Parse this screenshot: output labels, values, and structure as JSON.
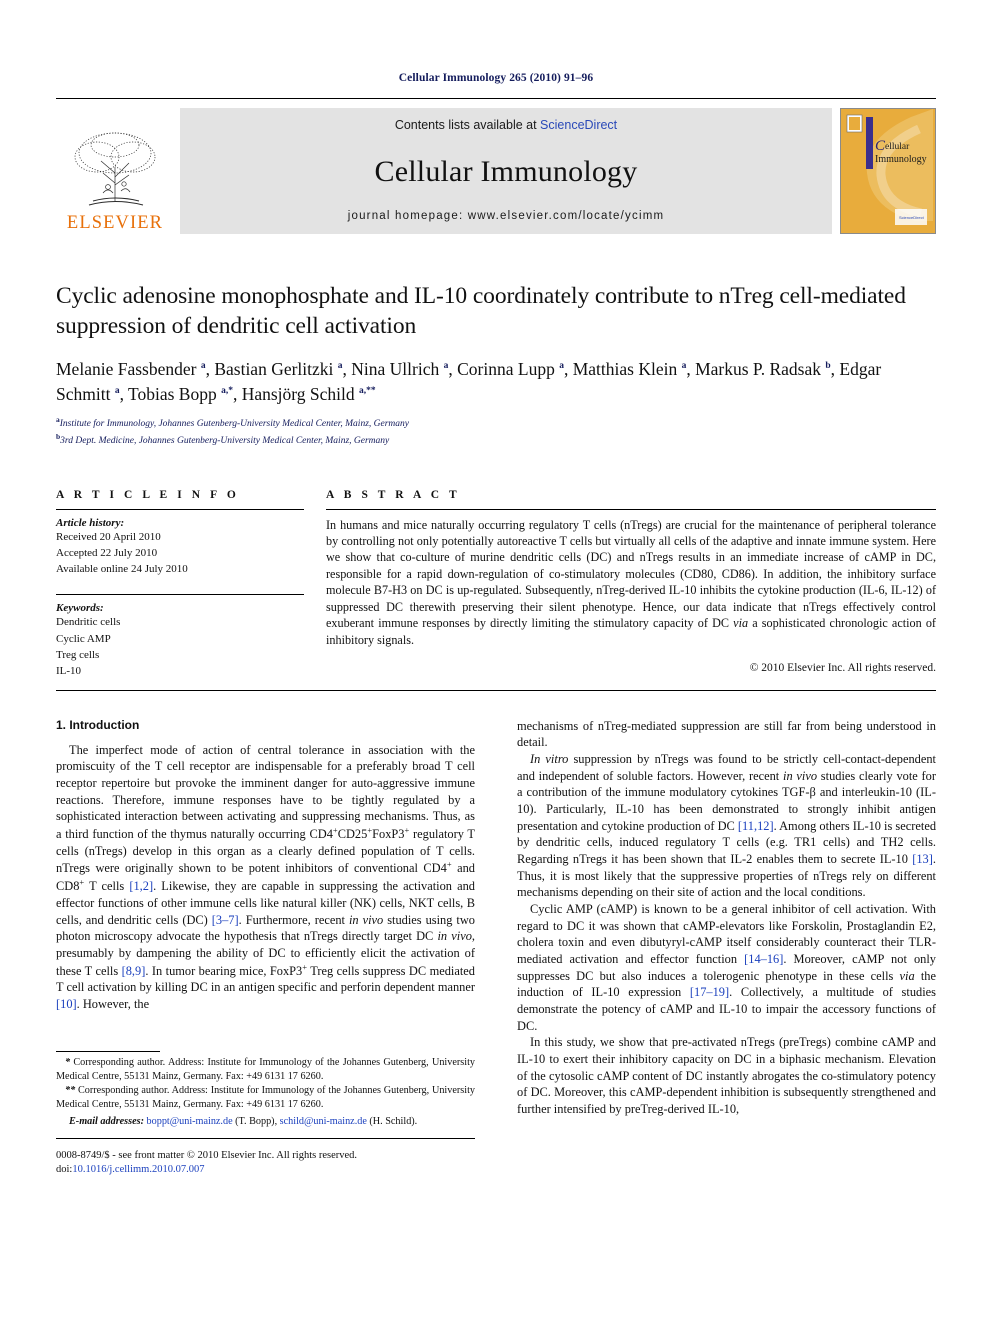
{
  "running_head": "Cellular Immunology 265 (2010) 91–96",
  "header": {
    "publisher_name": "ELSEVIER",
    "contents_prefix": "Contents lists available at ",
    "sciencedirect": "ScienceDirect",
    "journal_name": "Cellular Immunology",
    "homepage": "journal homepage: www.elsevier.com/locate/ycimm",
    "cover_title_line1": "ellular",
    "cover_title_line2": "Immunology",
    "cover_badge": "ScienceDirect",
    "accent_orange": "#e8700a",
    "cover_gold": "#e8ac3c",
    "link_blue": "#2a49b8",
    "navy": "#141c5c"
  },
  "article": {
    "title": "Cyclic adenosine monophosphate and IL-10 coordinately contribute to nTreg cell-mediated suppression of dendritic cell activation",
    "authors_html": "Melanie Fassbender <sup>a</sup>, Bastian Gerlitzki <sup>a</sup>, Nina Ullrich <sup>a</sup>, Corinna Lupp <sup>a</sup>, Matthias Klein <sup>a</sup>, Markus P. Radsak <sup>b</sup>, Edgar Schmitt <sup>a</sup>, Tobias Bopp <sup>a,*</sup>, Hansjörg Schild <sup>a,**</sup>",
    "affiliations": [
      {
        "marker": "a",
        "text": "Institute for Immunology, Johannes Gutenberg-University Medical Center, Mainz, Germany"
      },
      {
        "marker": "b",
        "text": "3rd Dept. Medicine, Johannes Gutenberg-University Medical Center, Mainz, Germany"
      }
    ]
  },
  "article_info": {
    "heading": "A R T I C L E  I N F O",
    "history_label": "Article history:",
    "history": [
      "Received 20 April 2010",
      "Accepted 22 July 2010",
      "Available online 24 July 2010"
    ],
    "keywords_label": "Keywords:",
    "keywords": [
      "Dendritic cells",
      "Cyclic AMP",
      "Treg cells",
      "IL-10"
    ]
  },
  "abstract": {
    "heading": "A B S T R A C T",
    "text_html": "In humans and mice naturally occurring regulatory T cells (nTregs) are crucial for the maintenance of peripheral tolerance by controlling not only potentially autoreactive T cells but virtually all cells of the adaptive and innate immune system. Here we show that co-culture of murine dendritic cells (DC) and nTregs results in an immediate increase of cAMP in DC, responsible for a rapid down-regulation of co-stimulatory molecules (CD80, CD86). In addition, the inhibitory surface molecule B7-H3 on DC is up-regulated. Subsequently, nTreg-derived IL-10 inhibits the cytokine production (IL-6, IL-12) of suppressed DC therewith preserving their silent phenotype. Hence, our data indicate that nTregs effectively control exuberant immune responses by directly limiting the stimulatory capacity of DC <i>via</i> a sophisticated chronologic action of inhibitory signals.",
    "copyright": "© 2010 Elsevier Inc. All rights reserved."
  },
  "body": {
    "section_heading": "1. Introduction",
    "left_paragraphs_html": [
      "The imperfect mode of action of central tolerance in association with the promiscuity of the T cell receptor are indispensable for a preferably broad T cell receptor repertoire but provoke the imminent danger for auto-aggressive immune reactions. Therefore, immune responses have to be tightly regulated by a sophisticated interaction between activating and suppressing mechanisms. Thus, as a third function of the thymus naturally occurring CD4<sup class=\"plus\">+</sup>CD25<sup class=\"plus\">+</sup>FoxP3<sup class=\"plus\">+</sup> regulatory T cells (nTregs) develop in this organ as a clearly defined population of T cells. nTregs were originally shown to be potent inhibitors of conventional CD4<sup class=\"plus\">+</sup> and CD8<sup class=\"plus\">+</sup> T cells <span class=\"ref\">[1,2]</span>. Likewise, they are capable in suppressing the activation and effector functions of other immune cells like natural killer (NK) cells, NKT cells, B cells, and dendritic cells (DC) <span class=\"ref\">[3–7]</span>. Furthermore, recent <i>in vivo</i> studies using two photon microscopy advocate the hypothesis that nTregs directly target DC <i>in vivo</i>, presumably by dampening the ability of DC to efficiently elicit the activation of these T cells <span class=\"ref\">[8,9]</span>. In tumor bearing mice, FoxP3<sup class=\"plus\">+</sup> Treg cells suppress DC mediated T cell activation by killing DC in an antigen specific and perforin dependent manner <span class=\"ref\">[10]</span>. However, the"
    ],
    "right_paragraphs_html": [
      "mechanisms of nTreg-mediated suppression are still far from being understood in detail.",
      "<i>In vitro</i> suppression by nTregs was found to be strictly cell-contact-dependent and independent of soluble factors. However, recent <i>in vivo</i> studies clearly vote for a contribution of the immune modulatory cytokines TGF-β and interleukin-10 (IL-10). Particularly, IL-10 has been demonstrated to strongly inhibit antigen presentation and cytokine production of DC <span class=\"ref\">[11,12]</span>. Among others IL-10 is secreted by dendritic cells, induced regulatory T cells (e.g. TR1 cells) and TH2 cells. Regarding nTregs it has been shown that IL-2 enables them to secrete IL-10 <span class=\"ref\">[13]</span>. Thus, it is most likely that the suppressive properties of nTregs rely on different mechanisms depending on their site of action and the local conditions.",
      "Cyclic AMP (cAMP) is known to be a general inhibitor of cell activation. With regard to DC it was shown that cAMP-elevators like Forskolin, Prostaglandin E2, cholera toxin and even dibutyryl-cAMP itself considerably counteract their TLR-mediated activation and effector function <span class=\"ref\">[14–16]</span>. Moreover, cAMP not only suppresses DC but also induces a tolerogenic phenotype in these cells <i>via</i> the induction of IL-10 expression <span class=\"ref\">[17–19]</span>. Collectively, a multitude of studies demonstrate the potency of cAMP and IL-10 to impair the accessory functions of DC.",
      "In this study, we show that pre-activated nTregs (preTregs) combine cAMP and IL-10 to exert their inhibitory capacity on DC in a biphasic mechanism. Elevation of the cytosolic cAMP content of DC instantly abrogates the co-stimulatory potency of DC. Moreover, this cAMP-dependent inhibition is subsequently strengthened and further intensified by preTreg-derived IL-10,"
    ]
  },
  "footnotes": {
    "corresponding_1_html": "<span class=\"em\">*</span> Corresponding author. Address: Institute for Immunology of the Johannes Gutenberg, University Medical Centre, 55131 Mainz, Germany. Fax: +49 6131 17 6260.",
    "corresponding_2_html": "<span class=\"em\">**</span> Corresponding author. Address: Institute for Immunology of the Johannes Gutenberg, University Medical Centre, 55131 Mainz, Germany. Fax: +49 6131 17 6260.",
    "email_html": "<span class=\"em\">E-mail addresses:</span> <span class=\"mail\">boppt@uni-mainz.de</span> (T. Bopp), <span class=\"mail\">schild@uni-mainz.de</span> (H. Schild).",
    "issn_html": "0008-8749/$ - see front matter © 2010 Elsevier Inc. All rights reserved.<br>doi:<span class=\"doi\">10.1016/j.cellimm.2010.07.007</span>"
  }
}
